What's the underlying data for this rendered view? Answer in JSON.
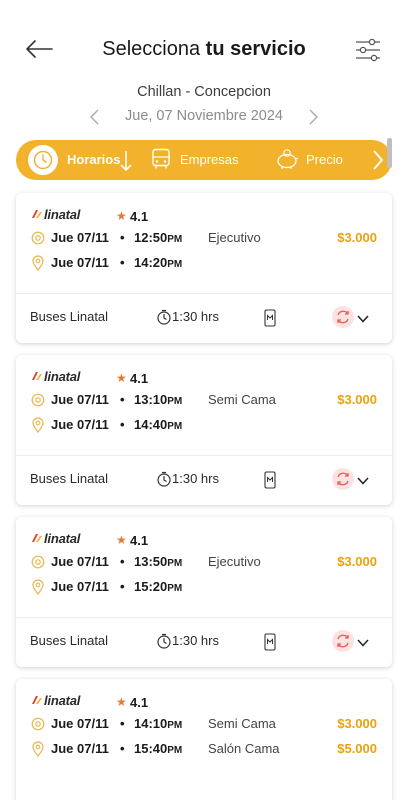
{
  "header": {
    "title_prefix": "Selecciona",
    "title_bold": "tu servicio",
    "back_icon": "arrow-left-icon",
    "filter_icon": "sliders-icon"
  },
  "route": "Chillan - Concepcion",
  "date": "Jue, 07 Noviembre 2024",
  "sort_tabs": [
    {
      "label": "Horarios",
      "icon": "clock-icon",
      "active": true
    },
    {
      "label": "Empresas",
      "icon": "bus-icon",
      "active": false
    },
    {
      "label": "Precio",
      "icon": "piggy-bank-icon",
      "active": false
    }
  ],
  "colors": {
    "accent": "#f2b22b",
    "price": "#eaa20f",
    "star": "#e27b33",
    "brand_red": "#e23a2f"
  },
  "cards": [
    {
      "brand": "linatal",
      "rating": "4.1",
      "rows": [
        {
          "date": "Jue 07/11",
          "time": "12:50",
          "ampm": "PM",
          "class": "Ejecutivo",
          "price": "$3.000"
        },
        {
          "date": "Jue 07/11",
          "time": "14:20",
          "ampm": "PM",
          "class": "",
          "price": ""
        }
      ],
      "company": "Buses Linatal",
      "duration": "1:30 hrs"
    },
    {
      "brand": "linatal",
      "rating": "4.1",
      "rows": [
        {
          "date": "Jue 07/11",
          "time": "13:10",
          "ampm": "PM",
          "class": "Semi Cama",
          "price": "$3.000"
        },
        {
          "date": "Jue 07/11",
          "time": "14:40",
          "ampm": "PM",
          "class": "",
          "price": ""
        }
      ],
      "company": "Buses Linatal",
      "duration": "1:30 hrs"
    },
    {
      "brand": "linatal",
      "rating": "4.1",
      "rows": [
        {
          "date": "Jue 07/11",
          "time": "13:50",
          "ampm": "PM",
          "class": "Ejecutivo",
          "price": "$3.000"
        },
        {
          "date": "Jue 07/11",
          "time": "15:20",
          "ampm": "PM",
          "class": "",
          "price": ""
        }
      ],
      "company": "Buses Linatal",
      "duration": "1:30 hrs"
    },
    {
      "brand": "linatal",
      "rating": "4.1",
      "rows": [
        {
          "date": "Jue 07/11",
          "time": "14:10",
          "ampm": "PM",
          "class": "Semi Cama",
          "price": "$3.000"
        },
        {
          "date": "Jue 07/11",
          "time": "15:40",
          "ampm": "PM",
          "class": "Salón Cama",
          "price": "$5.000"
        }
      ]
    }
  ]
}
